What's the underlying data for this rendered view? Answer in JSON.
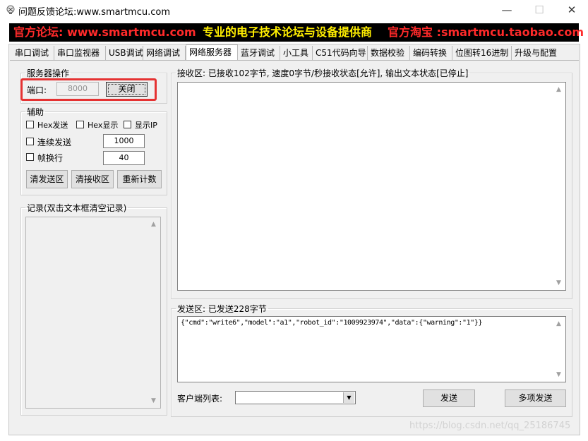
{
  "window": {
    "title": "问题反馈论坛:www.smartmcu.com",
    "min_glyph": "—",
    "max_glyph": "☐",
    "close_glyph": "✕",
    "icon": "app-icon"
  },
  "banner": {
    "forum": "官方论坛: www.smartmcu.com",
    "slogan": "专业的电子技术论坛与设备提供商",
    "shop": "官方淘宝 :smartmcu.taobao.com"
  },
  "tabs": [
    {
      "label": "串口调试"
    },
    {
      "label": "串口监视器"
    },
    {
      "label": "USB调试"
    },
    {
      "label": "网络调试"
    },
    {
      "label": "网络服务器",
      "active": true
    },
    {
      "label": "蓝牙调试"
    },
    {
      "label": "小工具"
    },
    {
      "label": "C51代码向导"
    },
    {
      "label": "数据校验"
    },
    {
      "label": "编码转换"
    },
    {
      "label": "位图转16进制"
    },
    {
      "label": "升级与配置"
    }
  ],
  "server": {
    "legend": "服务器操作",
    "port_label": "端口:",
    "port_value": "8000",
    "close_button": "关闭"
  },
  "aux": {
    "legend": "辅助",
    "hex_send": "Hex发送",
    "hex_display": "Hex显示",
    "show_ip": "显示IP",
    "continuous_send": "连续发送",
    "continuous_value": "1000",
    "frame_newline": "帧换行",
    "frame_value": "40",
    "clear_send": "清发送区",
    "clear_recv": "清接收区",
    "recount": "重新计数"
  },
  "log": {
    "legend": "记录(双击文本框清空记录)"
  },
  "receive": {
    "legend": "接收区: 已接收102字节, 速度0字节/秒接收状态[允许], 输出文本状态[已停止]"
  },
  "send": {
    "legend": "发送区: 已发送228字节",
    "content": "{\"cmd\":\"write6\",\"model\":\"a1\",\"robot_id\":\"1009923974\",\"data\":{\"warning\":\"1\"}}",
    "client_list_label": "客户端列表:",
    "send_button": "发送",
    "multi_send_button": "多项发送"
  },
  "watermark": "https://blog.csdn.net/qq_25186745"
}
